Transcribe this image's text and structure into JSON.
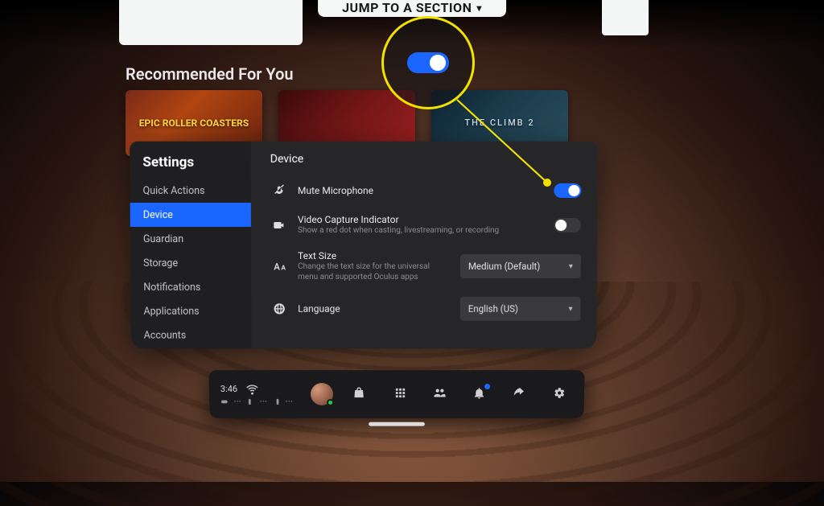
{
  "top_banner": "JUMP TO A SECTION",
  "recommend_title": "Recommended For You",
  "cards": {
    "c1": "EPIC ROLLER COASTERS",
    "c3": "THE CLIMB 2"
  },
  "sidebar": {
    "title": "Settings",
    "items": [
      {
        "label": "Quick Actions"
      },
      {
        "label": "Device"
      },
      {
        "label": "Guardian"
      },
      {
        "label": "Storage"
      },
      {
        "label": "Notifications"
      },
      {
        "label": "Applications"
      },
      {
        "label": "Accounts"
      }
    ]
  },
  "panel": {
    "title": "Device",
    "mute": {
      "label": "Mute Microphone"
    },
    "vci": {
      "label": "Video Capture Indicator",
      "sub": "Show a red dot when casting, livestreaming, or recording"
    },
    "textsize": {
      "label": "Text Size",
      "sub": "Change the text size for the universal menu and supported Oculus apps",
      "value": "Medium (Default)"
    },
    "language": {
      "label": "Language",
      "value": "English (US)"
    }
  },
  "dock": {
    "time": "3:46"
  }
}
